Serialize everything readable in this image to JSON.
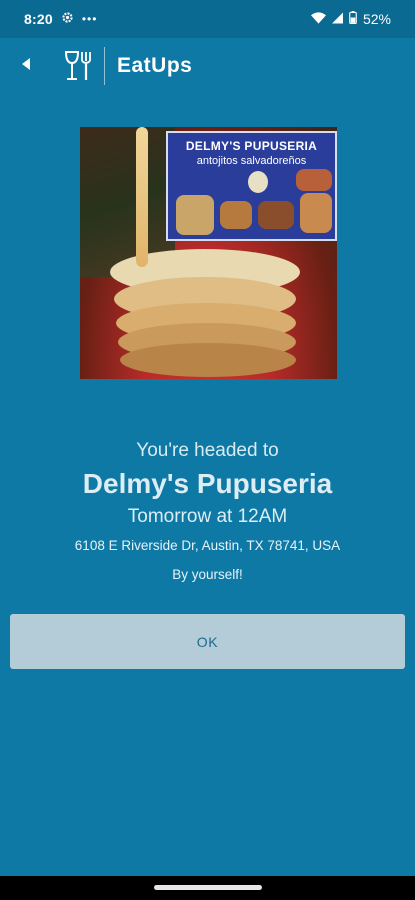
{
  "status_bar": {
    "time": "8:20",
    "dots": "•••",
    "battery": "52%"
  },
  "app_bar": {
    "title": "EatUps"
  },
  "photo": {
    "sign_title": "DELMY'S PUPUSERIA",
    "sign_subtitle": "antojitos salvadoreños"
  },
  "reservation": {
    "headed_label": "You're headed to",
    "restaurant_name": "Delmy's Pupuseria",
    "time": "Tomorrow at 12AM",
    "address": "6108 E Riverside Dr, Austin, TX 78741, USA",
    "party": "By yourself!"
  },
  "ok_label": "OK",
  "colors": {
    "background": "#0f79a6",
    "status_bar": "#0b6a92",
    "button": "#b4cbd8",
    "button_text": "#1c6b8f"
  },
  "icons": {
    "back": "back-arrow-icon",
    "logo": "glass-fork-icon"
  }
}
